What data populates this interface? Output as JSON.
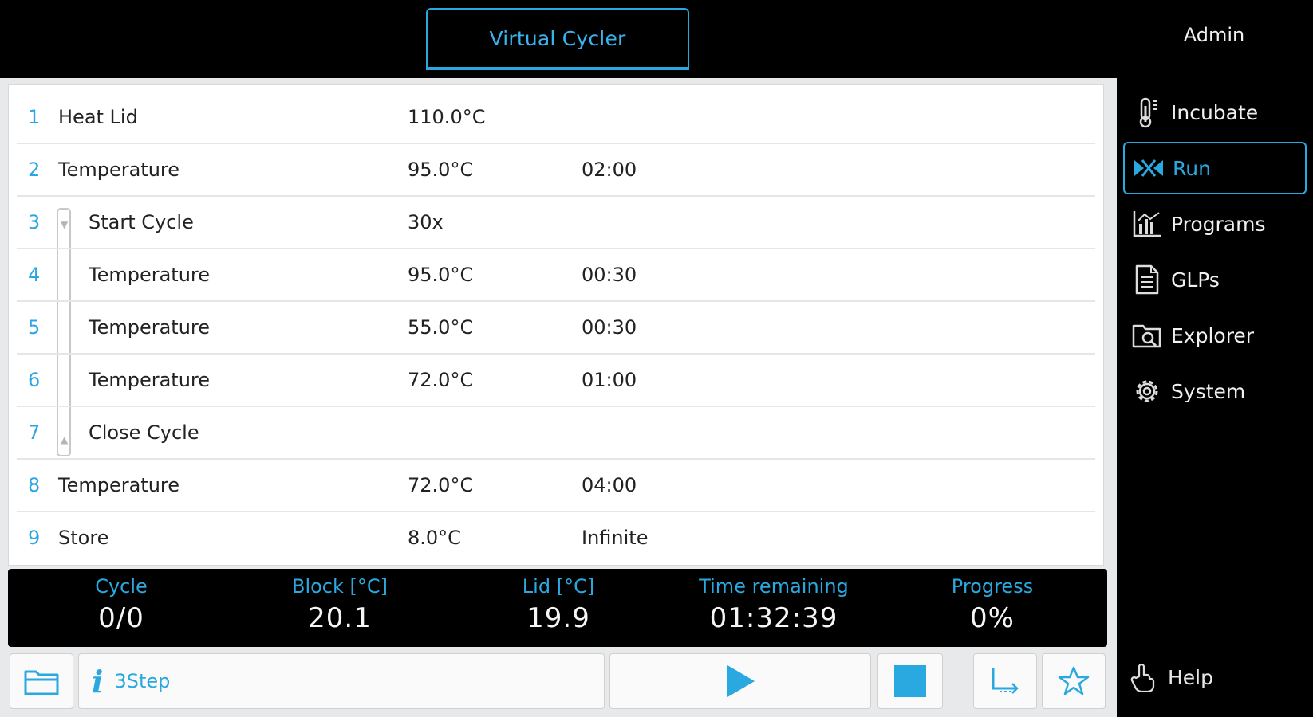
{
  "header": {
    "title": "Virtual Cycler",
    "user": "Admin"
  },
  "steps": [
    {
      "num": "1",
      "name": "Heat Lid",
      "value": "110.0°C",
      "time": ""
    },
    {
      "num": "2",
      "name": "Temperature",
      "value": "95.0°C",
      "time": "02:00"
    },
    {
      "num": "3",
      "name": "Start Cycle",
      "value": "30x",
      "time": ""
    },
    {
      "num": "4",
      "name": "Temperature",
      "value": "95.0°C",
      "time": "00:30"
    },
    {
      "num": "5",
      "name": "Temperature",
      "value": "55.0°C",
      "time": "00:30"
    },
    {
      "num": "6",
      "name": "Temperature",
      "value": "72.0°C",
      "time": "01:00"
    },
    {
      "num": "7",
      "name": "Close Cycle",
      "value": "",
      "time": ""
    },
    {
      "num": "8",
      "name": "Temperature",
      "value": "72.0°C",
      "time": "04:00"
    },
    {
      "num": "9",
      "name": "Store",
      "value": "8.0°C",
      "time": "Infinite"
    }
  ],
  "status": {
    "cycle": {
      "label": "Cycle",
      "value": "0/0"
    },
    "block": {
      "label": "Block [°C]",
      "value": "20.1"
    },
    "lid": {
      "label": "Lid [°C]",
      "value": "19.9"
    },
    "time_remaining": {
      "label": "Time remaining",
      "value": "01:32:39"
    },
    "progress": {
      "label": "Progress",
      "value": "0%"
    }
  },
  "toolbar": {
    "info_text": "3Step"
  },
  "sidebar": {
    "items": [
      {
        "label": "Incubate",
        "icon": "thermometer-icon"
      },
      {
        "label": "Run",
        "icon": "run-icon"
      },
      {
        "label": "Programs",
        "icon": "programs-chart-icon"
      },
      {
        "label": "GLPs",
        "icon": "document-icon"
      },
      {
        "label": "Explorer",
        "icon": "folder-search-icon"
      },
      {
        "label": "System",
        "icon": "gear-icon"
      }
    ],
    "help": "Help"
  },
  "colors": {
    "accent": "#2aa8e0",
    "background": "#000000",
    "panel": "#ffffff"
  }
}
